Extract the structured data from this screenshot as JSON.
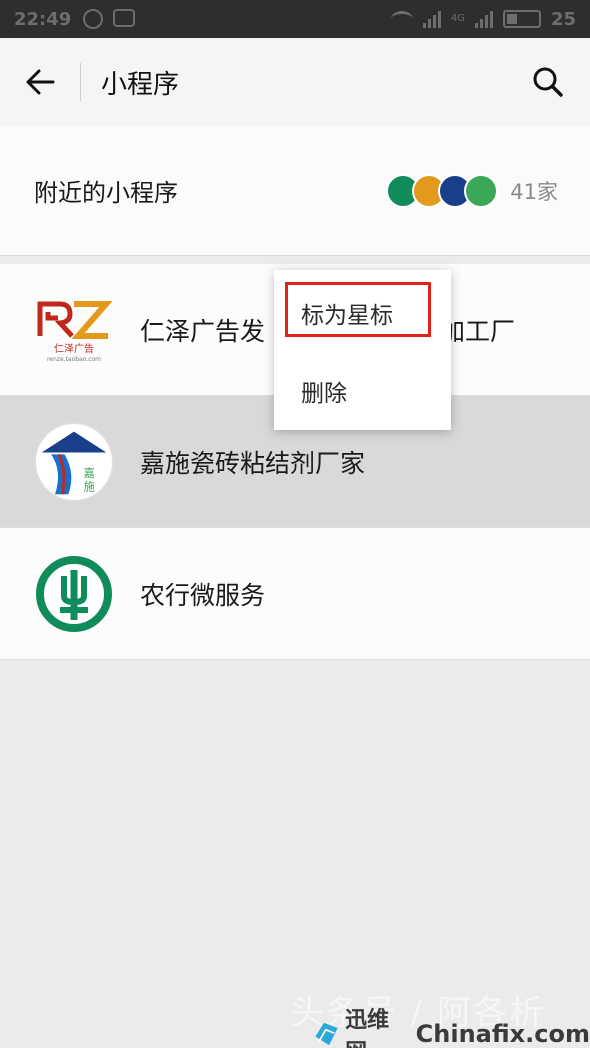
{
  "status_bar": {
    "time": "22:49",
    "network_label": "4G",
    "battery": "25"
  },
  "header": {
    "title": "小程序",
    "back_icon": "arrow-left-icon",
    "search_icon": "search-icon"
  },
  "nearby": {
    "label": "附近的小程序",
    "count": "41家"
  },
  "list": {
    "items": [
      {
        "label": "仁泽广告发",
        "label_tail": "加工厂",
        "icon_text": "RZ",
        "icon_sub": "仁泽广告",
        "icon_url_text": "renze.taobao.com"
      },
      {
        "label": "嘉施瓷砖粘结剂厂家",
        "icon_text": "嘉施"
      },
      {
        "label": "农行微服务"
      }
    ]
  },
  "popup_menu": {
    "star_label": "标为星标",
    "delete_label": "删除",
    "highlight_color": "#e0221c"
  },
  "watermark": {
    "text": "头条号 / 阿各析",
    "brand": "迅维网",
    "site": "Chinafix.com"
  },
  "colors": {
    "abc_green": "#0f8c5a",
    "rz_red": "#c0281c",
    "rz_gold": "#e39a1c",
    "jiashi_blue": "#1a3f8a"
  }
}
